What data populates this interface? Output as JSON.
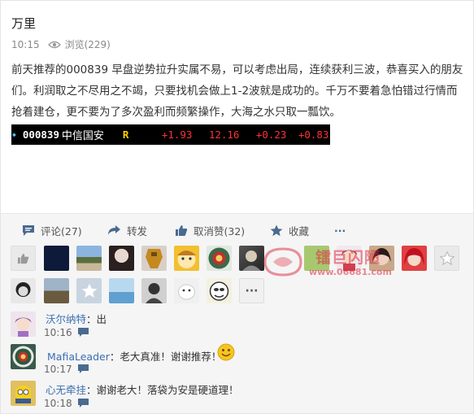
{
  "post": {
    "author": "万里",
    "time": "10:15",
    "views": "浏览(229)",
    "content": "前天推荐的000839 早盘逆势拉升实属不易，可以考虑出局，连续获利三波，恭喜买入的朋友们。利润取之不尽用之不竭，只要找机会做上1-2波就是成功的。千万不要着急怕错过行情而抢着建仓，更不要为了多次盈利而频繁操作，大海之水只取一瓢饮。"
  },
  "quote": {
    "code": "000839",
    "name": "中信国安",
    "flag": "R",
    "change_pct": "+1.93",
    "price": "12.16",
    "change": "+0.23",
    "value4": "+0.83",
    "colors": {
      "background": "#000000",
      "up": "#ff3232",
      "code": "#ffffff",
      "flag": "#ffd700"
    }
  },
  "actions": {
    "comment": "评论(27)",
    "forward": "转发",
    "unlike": "取消赞(32)",
    "favorite": "收藏",
    "more": "···"
  },
  "watermark": {
    "text": "镭巨闪陋",
    "url": "www.06681.com"
  },
  "comments": [
    {
      "name": "沃尔纳特",
      "text": "：出",
      "time": "10:16"
    },
    {
      "name": "MafiaLeader",
      "text": "：老大真准！谢谢推荐！",
      "time": "10:17"
    },
    {
      "name": "心无牵挂",
      "text": "：谢谢老大！落袋为安是硬道理！",
      "time": "10:18"
    }
  ]
}
